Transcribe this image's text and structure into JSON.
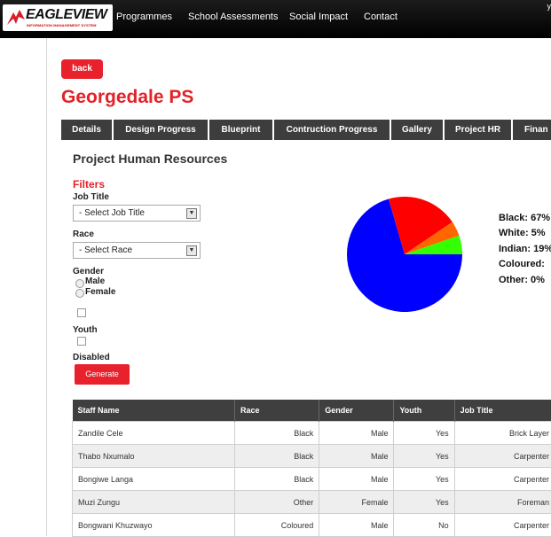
{
  "header": {
    "logo_text": "EAGLEVIEW",
    "logo_subtext": "INFORMATION MANAGEMENT SYSTEM",
    "nav": [
      "Programmes",
      "School Assessments",
      "Social Impact",
      "Contact"
    ],
    "top_right": "y"
  },
  "back_label": "back",
  "page_title": "Georgedale PS",
  "tabs": [
    "Details",
    "Design Progress",
    "Blueprint",
    "Contruction Progress",
    "Gallery",
    "Project HR",
    "Finan"
  ],
  "section_title": "Project Human Resources",
  "filters": {
    "heading": "Filters",
    "job_title_label": "Job Title",
    "job_title_value": "- Select Job Title",
    "race_label": "Race",
    "race_value": "- Select Race",
    "gender_label": "Gender",
    "male_label": "Male",
    "female_label": "Female",
    "youth_label": "Youth",
    "disabled_label": "Disabled",
    "generate_label": "Generate"
  },
  "chart_data": {
    "type": "pie",
    "slices": [
      {
        "label": "Black",
        "value": 67,
        "color": "#0000ff"
      },
      {
        "label": "Indian",
        "value": 19,
        "color": "#ff0000"
      },
      {
        "label": "Coloured",
        "value": 4,
        "color": "#ff6600"
      },
      {
        "label": "White",
        "value": 5,
        "color": "#33ff00"
      },
      {
        "label": "Other",
        "value": 0,
        "color": "#999999"
      }
    ],
    "legend": [
      "Black: 67%",
      "White: 5%",
      "Indian: 19%",
      "Coloured: ",
      "Other: 0%"
    ]
  },
  "table": {
    "headers": [
      "Staff Name",
      "Race",
      "Gender",
      "Youth",
      "Job Title"
    ],
    "rows": [
      [
        "Zandile Cele",
        "Black",
        "Male",
        "Yes",
        "Brick Layer"
      ],
      [
        "Thabo Nxumalo",
        "Black",
        "Male",
        "Yes",
        "Carpenter"
      ],
      [
        "Bongiwe Langa",
        "Black",
        "Male",
        "Yes",
        "Carpenter"
      ],
      [
        "Muzi Zungu",
        "Other",
        "Female",
        "Yes",
        "Foreman"
      ],
      [
        "Bongwani Khuzwayo",
        "Coloured",
        "Male",
        "No",
        "Carpenter"
      ]
    ]
  },
  "colors": {
    "accent": "#e32228",
    "nav_bg": "#000000",
    "tab_bg": "#3d3d3d"
  }
}
